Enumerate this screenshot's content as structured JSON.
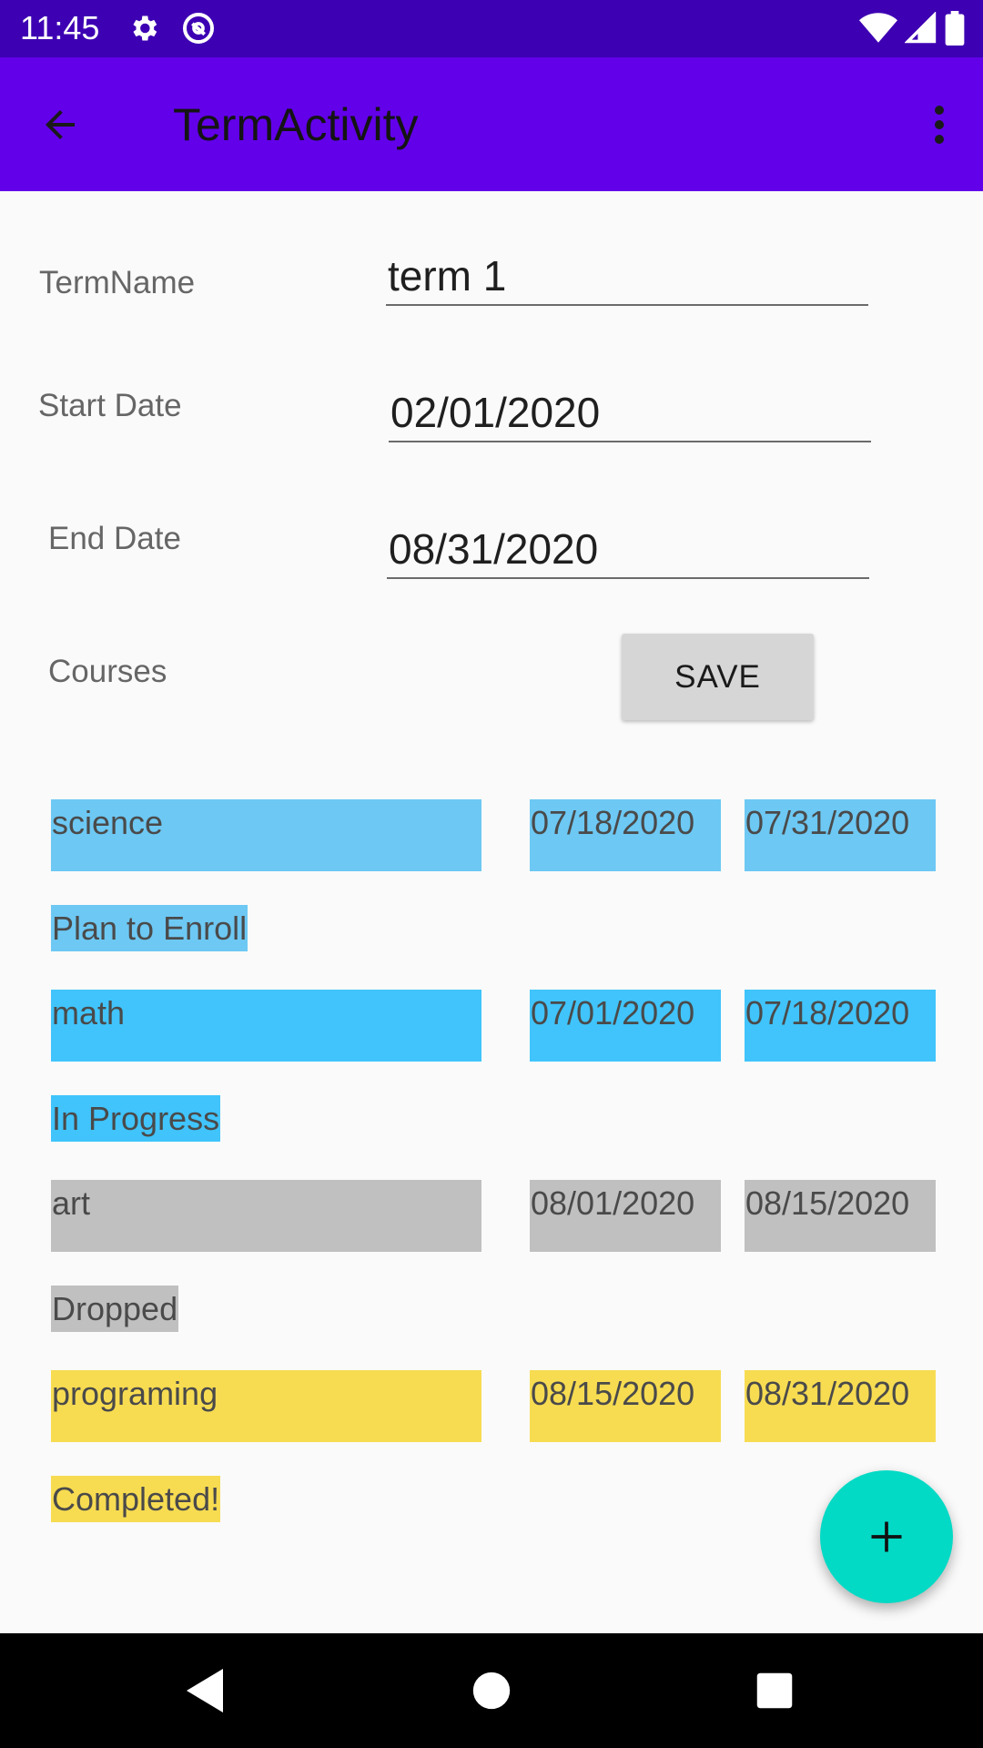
{
  "status_bar": {
    "time": "11:45",
    "icons": [
      "gear-icon",
      "at-sign-icon",
      "wifi-icon",
      "signal-icon",
      "battery-icon"
    ]
  },
  "app_bar": {
    "title": "TermActivity",
    "back_icon": "arrow-back-icon",
    "overflow_icon": "more-vert-icon"
  },
  "form": {
    "term_name_label": "TermName",
    "term_name_value": "term 1",
    "start_date_label": "Start Date",
    "start_date_value": "02/01/2020",
    "end_date_label": "End Date",
    "end_date_value": "08/31/2020",
    "courses_label": "Courses",
    "save_label": "SAVE"
  },
  "courses": [
    {
      "name": "science",
      "start": "07/18/2020",
      "end": "07/31/2020",
      "status": "Plan to Enroll",
      "color": "#6dc8f3"
    },
    {
      "name": "math",
      "start": "07/01/2020",
      "end": "07/18/2020",
      "status": "In Progress",
      "color": "#40c4fb"
    },
    {
      "name": "art",
      "start": "08/01/2020",
      "end": "08/15/2020",
      "status": "Dropped",
      "color": "#c0c0c0"
    },
    {
      "name": "programing",
      "start": "08/15/2020",
      "end": "08/31/2020",
      "status": "Completed!",
      "color": "#f7dc52"
    }
  ],
  "fab": {
    "icon": "plus-icon",
    "color": "#03dac5"
  },
  "nav_bar": {
    "icons": [
      "nav-back-icon",
      "nav-home-icon",
      "nav-recents-icon"
    ]
  }
}
